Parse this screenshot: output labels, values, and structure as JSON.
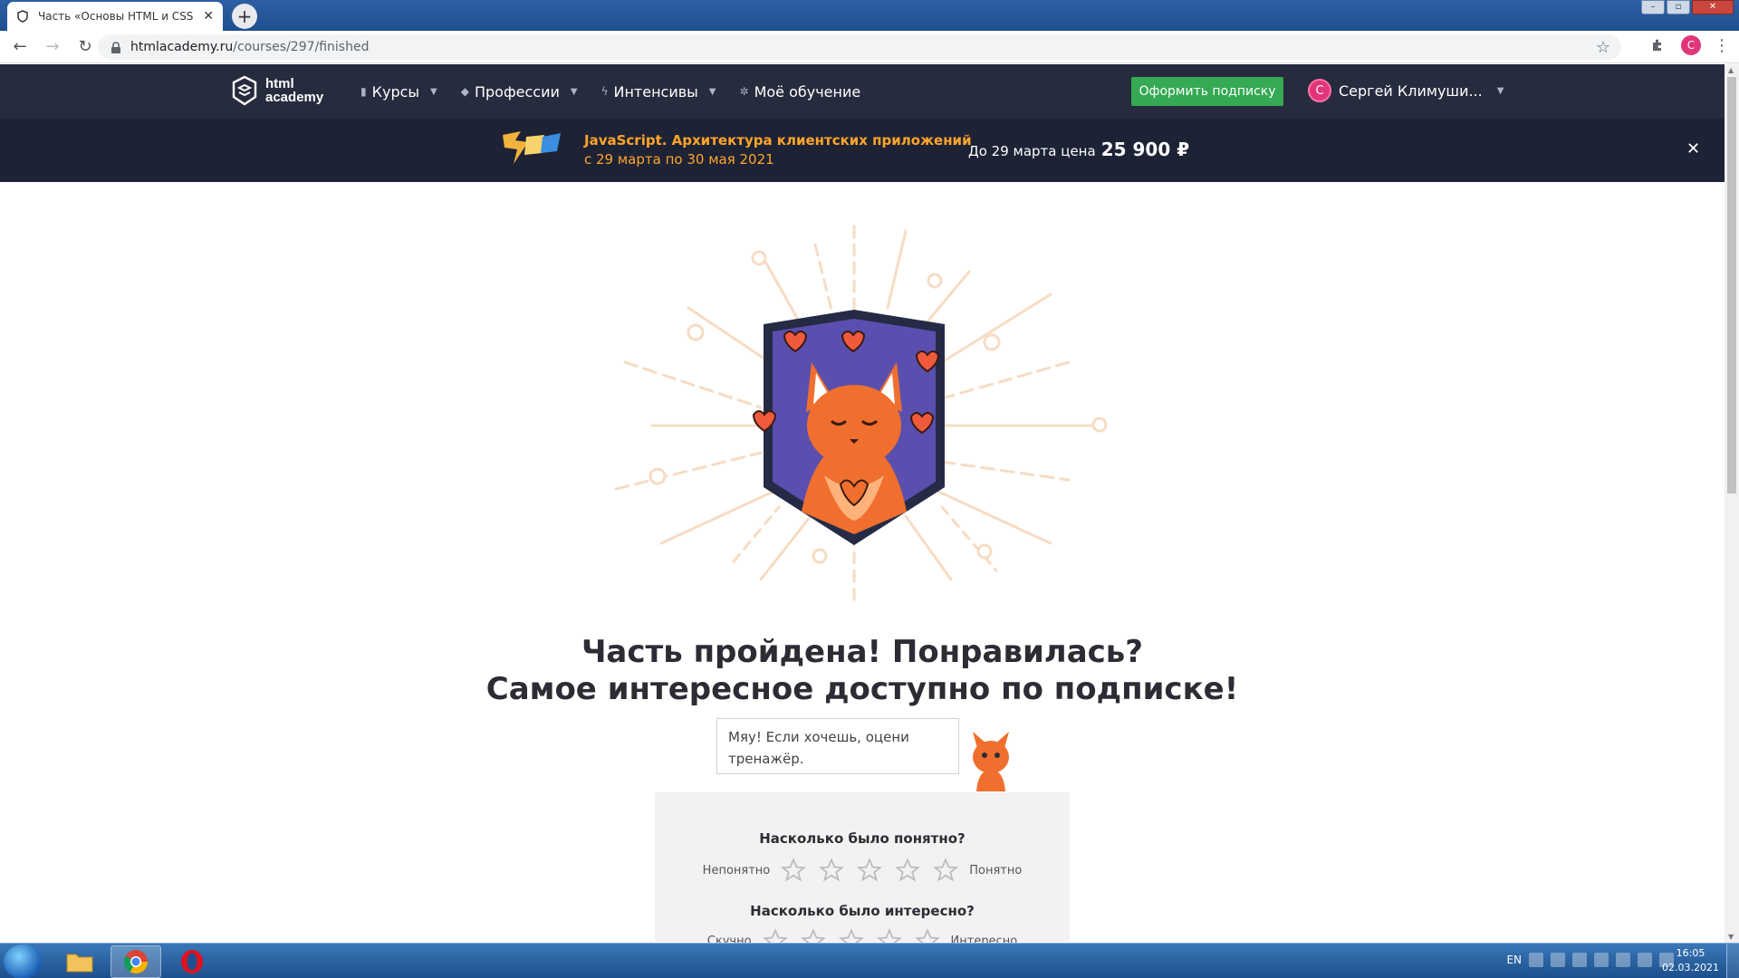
{
  "browser": {
    "tab_title": "Часть «Основы HTML и CSS» пр",
    "new_tab_symbol": "+",
    "url_host": "htmlacademy.ru",
    "url_path": "/courses/297/finished",
    "profile_letter": "С"
  },
  "header": {
    "logo_line1": "html",
    "logo_line2": "academy",
    "nav": [
      {
        "label": "Курсы",
        "icon": "bars-icon"
      },
      {
        "label": "Профессии",
        "icon": "graduation-cap-icon"
      },
      {
        "label": "Интенсивы",
        "icon": "lightning-icon"
      },
      {
        "label": "Моё обучение",
        "icon": "paw-icon"
      }
    ],
    "subscribe_label": "Оформить подписку",
    "user_name": "Сергей Климуши...",
    "user_initial": "С"
  },
  "promo": {
    "title": "JavaScript. Архитектура клиентских приложений",
    "dates": "с 29 марта по 30 мая 2021",
    "price_prefix": "До 29 марта цена",
    "price": "25 900 ₽",
    "close": "✕",
    "accent_color": "#ffa52b"
  },
  "main": {
    "headline_line1": "Часть пройдена! Понравилась?",
    "headline_line2": "Самое интересное доступно по подписке!",
    "bubble_text": "Мяу! Если хочешь, оцени тренажёр.",
    "rating": {
      "q1_title": "Насколько было понятно?",
      "q1_low": "Непонятно",
      "q1_high": "Понятно",
      "q2_title": "Насколько было интересно?",
      "q2_low": "Скучно",
      "q2_high": "Интересно"
    }
  },
  "taskbar": {
    "lang": "EN",
    "time": "16:05",
    "date": "02.03.2021"
  }
}
